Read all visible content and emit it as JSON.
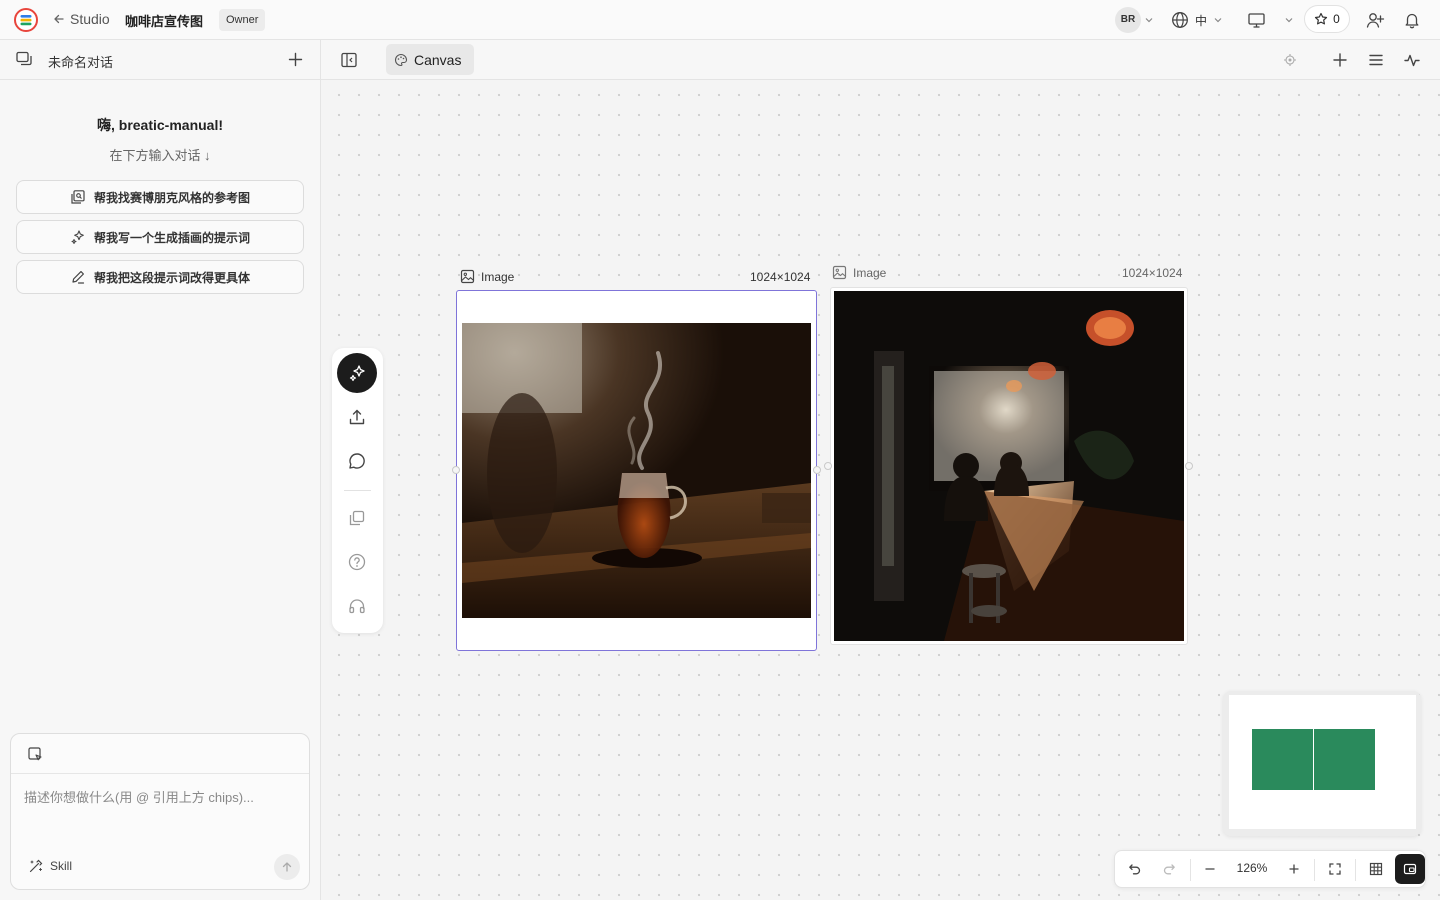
{
  "header": {
    "back_label": "Studio",
    "project_name": "咖啡店宣传图",
    "role_badge": "Owner",
    "avatar_initials": "BR",
    "language": "中",
    "star_count": "0"
  },
  "sidebar": {
    "chat_title": "未命名对话",
    "greeting": "嗨, breatic-manual!",
    "hint": "在下方输入对话 ↓",
    "suggestions": [
      {
        "label": "帮我找赛博朋克风格的参考图",
        "icon": "image-search-icon"
      },
      {
        "label": "帮我写一个生成插画的提示词",
        "icon": "sparkles-icon"
      },
      {
        "label": "帮我把这段提示词改得更具体",
        "icon": "pencil-icon"
      }
    ],
    "input_placeholder": "描述你想做什么(用 @ 引用上方 chips)...",
    "skill_label": "Skill"
  },
  "canvas_bar": {
    "tab_label": "Canvas"
  },
  "canvas": {
    "images": [
      {
        "label": "Image",
        "dims": "1024×1024",
        "content": "steaming glass coffee server on wooden table",
        "selected": true
      },
      {
        "label": "Image",
        "dims": "1024×1024",
        "content": "dim café interior with silhouetted customers at a window bar",
        "selected": false
      }
    ],
    "minimap_color": "#2a8a5c",
    "accent_color": "#6b5fd6"
  },
  "zoom": {
    "level": "126%"
  }
}
